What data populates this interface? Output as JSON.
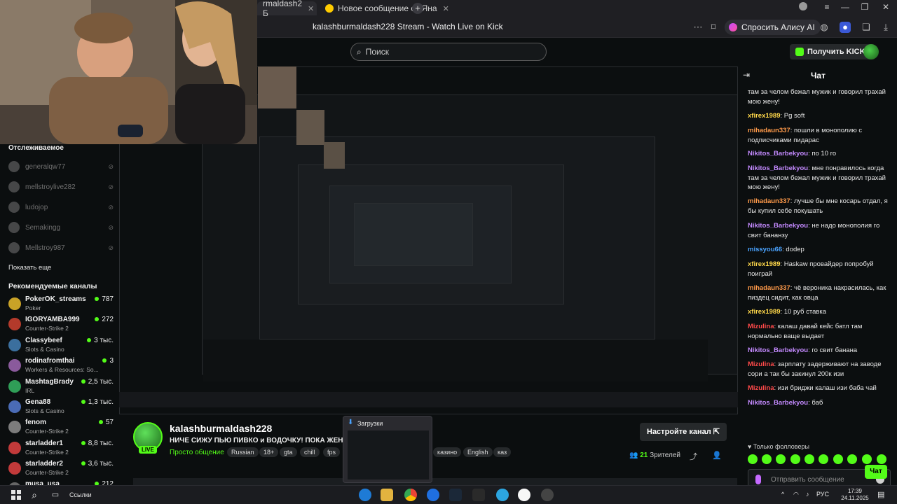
{
  "browser": {
    "tabs": [
      {
        "label": "rmaldash2 Б",
        "active": true
      },
      {
        "label": "Новое сообщение от Яна",
        "active": false
      }
    ],
    "page_title": "kalashburmaldash228 Stream - Watch Live on Kick",
    "alice_label": "Спросить Алису AI"
  },
  "header": {
    "search_placeholder": "Поиск",
    "kicks_button": "Получить KICKs"
  },
  "sidebar": {
    "followed_heading": "Отслеживаемое",
    "followed": [
      {
        "name": "generalqw77"
      },
      {
        "name": "mellstroylive282"
      },
      {
        "name": "ludojop"
      },
      {
        "name": "Semakingg"
      },
      {
        "name": "Mellstroy987"
      }
    ],
    "show_more": "Показать еще",
    "recommended_heading": "Рекомендуемые каналы",
    "recommended": [
      {
        "name": "PokerOK_streams",
        "category": "Poker",
        "viewers": "787",
        "color": "#c9a227"
      },
      {
        "name": "IGORYAMBA999",
        "category": "Counter-Strike 2",
        "viewers": "272",
        "color": "#b33a2b"
      },
      {
        "name": "Classybeef",
        "category": "Slots & Casino",
        "viewers": "3 тыс.",
        "color": "#3b6f9e"
      },
      {
        "name": "rodinafromthai",
        "category": "Workers & Resources: So...",
        "viewers": "3",
        "color": "#8a5a9c"
      },
      {
        "name": "MashtagBrady",
        "category": "IRL",
        "viewers": "2,5 тыс.",
        "color": "#2f9e57"
      },
      {
        "name": "Gena88",
        "category": "Slots & Casino",
        "viewers": "1,3 тыс.",
        "color": "#4a6bb5"
      },
      {
        "name": "fenom",
        "category": "Counter-Strike 2",
        "viewers": "57",
        "color": "#7c7c7c"
      },
      {
        "name": "starladder1",
        "category": "Counter-Strike 2",
        "viewers": "8,8 тыс.",
        "color": "#c23a3a"
      },
      {
        "name": "starladder2",
        "category": "Counter-Strike 2",
        "viewers": "3,6 тыс.",
        "color": "#c23a3a"
      },
      {
        "name": "musa_usa",
        "category": "",
        "viewers": "212",
        "color": "#666666"
      }
    ]
  },
  "channel": {
    "name": "kalashburmaldash228",
    "live": "LIVE",
    "title": "НИЧЕ СИЖУ ПЬЮ ПИВКО и ВОДОЧКУ! ПОКА ЖЕНА Н",
    "category": "Просто общение",
    "tags": [
      "Russian",
      "18+",
      "gta",
      "chill",
      "fps",
      "казино",
      "English",
      "каз"
    ],
    "configure_button": "Настройте канал",
    "viewers_count": "21",
    "viewers_label": "Зрителей"
  },
  "downloads_popup": {
    "title": "Загрузки"
  },
  "chat": {
    "title": "Чат",
    "messages": [
      {
        "user": "",
        "text": "там за челом бежал мужик и говорил трахай мою жену!",
        "color": "#b07cff"
      },
      {
        "user": "xfirex1989",
        "text": "Pg soft",
        "color": "#ffd84a"
      },
      {
        "user": "mihadaun337",
        "text": "пошли в монополию с подписчиками пидарас",
        "color": "#ff9a4a"
      },
      {
        "user": "Nikitos_Barbekyou",
        "text": "по 10 го",
        "color": "#c48aff"
      },
      {
        "user": "Nikitos_Barbekyou",
        "text": "мне понравилось когда там за челом бежал мужик и говорил трахай мою жену!",
        "color": "#c48aff"
      },
      {
        "user": "mihadaun337",
        "text": "лучше бы мне косарь отдал, я бы купил себе покушать",
        "color": "#ff9a4a"
      },
      {
        "user": "Nikitos_Barbekyou",
        "text": "не надо монополия го свит бананзу",
        "color": "#c48aff"
      },
      {
        "user": "missyou66",
        "text": "dodep",
        "color": "#4aa3ff"
      },
      {
        "user": "xfirex1989",
        "text": "Haskaw провайдер попробуй поиграй",
        "color": "#ffd84a"
      },
      {
        "user": "mihadaun337",
        "text": "чё вероника накрасилась, как пиздец сидит, как овца",
        "color": "#ff9a4a"
      },
      {
        "user": "xfirex1989",
        "text": "10 руб ставка",
        "color": "#ffd84a"
      },
      {
        "user": "Mizulina",
        "text": "калаш давай кейс батл там нормально ваще выдает",
        "color": "#ff4a4a"
      },
      {
        "user": "Nikitos_Barbekyou",
        "text": "го свит банана",
        "color": "#c48aff"
      },
      {
        "user": "Mizulina",
        "text": "зарплату задерживают на заводе сори а так бы закинул 200к изи",
        "color": "#ff4a4a"
      },
      {
        "user": "Mizulina",
        "text": "изи бриджи калаш изи баба чай",
        "color": "#ff4a4a"
      },
      {
        "user": "Nikitos_Barbekyou",
        "text": "баб",
        "color": "#c48aff"
      }
    ],
    "only_followers": "Только фолловеры",
    "input_placeholder": "Отправить сообщение",
    "send_button": "Чат"
  },
  "taskbar": {
    "links_label": "Ссылки",
    "lang": "РУС",
    "time": "17:39",
    "date": "24.11.2025"
  }
}
